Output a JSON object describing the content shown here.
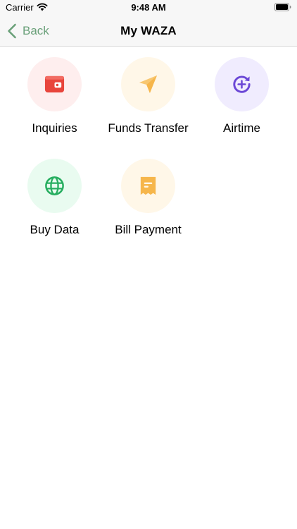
{
  "status_bar": {
    "carrier": "Carrier",
    "time": "9:48 AM"
  },
  "nav": {
    "back_label": "Back",
    "title": "My WAZA",
    "accent_color": "#6aa079"
  },
  "menu": [
    {
      "label": "Inquiries",
      "icon": "wallet-icon",
      "icon_color": "#e8453c",
      "bg_color": "#feeeee"
    },
    {
      "label": "Funds Transfer",
      "icon": "paper-plane-icon",
      "icon_color": "#f6b64b",
      "bg_color": "#fff7e8"
    },
    {
      "label": "Airtime",
      "icon": "refresh-plus-icon",
      "icon_color": "#6b47d6",
      "bg_color": "#f0ecfe"
    },
    {
      "label": "Buy Data",
      "icon": "globe-icon",
      "icon_color": "#27ae60",
      "bg_color": "#e9fbf0"
    },
    {
      "label": "Bill Payment",
      "icon": "receipt-icon",
      "icon_color": "#f6b64b",
      "bg_color": "#fff7e8"
    }
  ]
}
